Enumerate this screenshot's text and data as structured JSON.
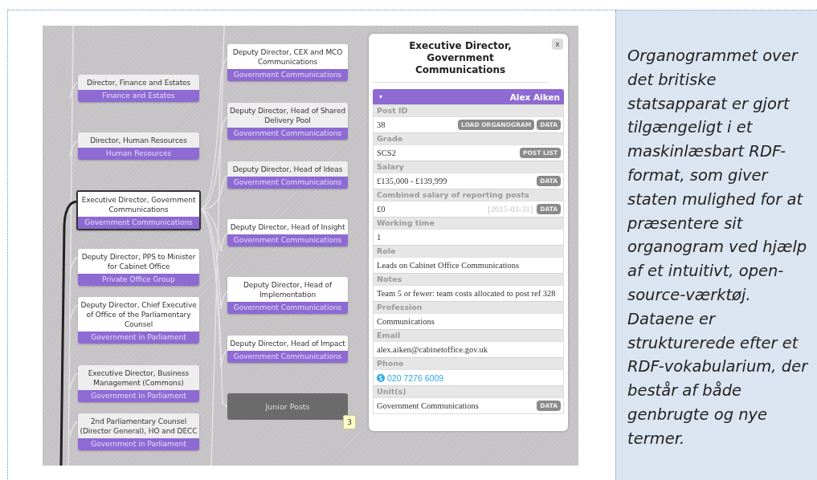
{
  "organogram": {
    "left_nodes": [
      {
        "title": "Director, Finance and Estates",
        "unit": "Finance and Estates",
        "greyed": true,
        "selected": false
      },
      {
        "title": "Director, Human Resources",
        "unit": "Human Resources",
        "greyed": true,
        "selected": false
      },
      {
        "title": "Executive Director, Government Communications",
        "unit": "Government Communications",
        "greyed": false,
        "selected": true
      },
      {
        "title": "Deputy Director, PPS to Minister for Cabinet Office",
        "unit": "Private Office Group",
        "greyed": false,
        "selected": false
      },
      {
        "title": "Deputy Director, Chief Executive of Office of the Parliamentary Counsel",
        "unit": "Government in Parliament",
        "greyed": false,
        "selected": false
      },
      {
        "title": "Executive Director, Business Management (Commons)",
        "unit": "Government in Parliament",
        "greyed": true,
        "selected": false
      },
      {
        "title": "2nd Parliamentary Counsel (Director General), HO and DECC",
        "unit": "Government in Parliament",
        "greyed": true,
        "selected": false
      }
    ],
    "right_nodes": [
      {
        "title": "Deputy Director, CEX and MCO Communications",
        "unit": "Government Communications",
        "greyed": false,
        "selected": false
      },
      {
        "title": "Deputy Director, Head of Shared Delivery Pool",
        "unit": "Government Communications",
        "greyed": true,
        "selected": false
      },
      {
        "title": "Deputy Director, Head of Ideas",
        "unit": "Government Communications",
        "greyed": true,
        "selected": false
      },
      {
        "title": "Deputy Director, Head of Insight",
        "unit": "Government Communications",
        "greyed": false,
        "selected": false
      },
      {
        "title": "Deputy Director, Head of Implementation",
        "unit": "Government Communications",
        "greyed": false,
        "selected": false
      },
      {
        "title": "Deputy Director, Head of Impact",
        "unit": "Government Communications",
        "greyed": false,
        "selected": false
      }
    ],
    "junior_posts": {
      "label": "Junior Posts",
      "count": "3"
    }
  },
  "info_panel": {
    "title": "Executive Director, Government Communications",
    "close": "x",
    "person": {
      "toggle": "▾",
      "name": "Alex Aiken"
    },
    "fields": [
      {
        "label": "Post ID",
        "value": "38",
        "kind": "text",
        "buttons": [
          "LOAD ORGANOGRAM",
          "DATA"
        ]
      },
      {
        "label": "Grade",
        "value": "SCS2",
        "kind": "text",
        "buttons": [
          "POST LIST"
        ]
      },
      {
        "label": "Salary",
        "value": "£135,000 - £139,999",
        "kind": "text",
        "buttons": [
          "DATA"
        ]
      },
      {
        "label": "Combined salary of reporting posts",
        "value": "£0",
        "date": "[2015-03-31]",
        "kind": "text",
        "buttons": [
          "DATA"
        ]
      },
      {
        "label": "Working time",
        "value": "1",
        "kind": "text"
      },
      {
        "label": "Role",
        "value": "Leads on Cabinet Office Communications",
        "kind": "text"
      },
      {
        "label": "Notes",
        "value": "Team 5 or fewer: team costs allocated to post ref 328",
        "kind": "text"
      },
      {
        "label": "Profession",
        "value": "Communications",
        "kind": "text"
      },
      {
        "label": "Email",
        "value": "alex.aiken@cabinetoffice.gov.uk",
        "kind": "text"
      },
      {
        "label": "Phone",
        "value": "020 7276 6009",
        "kind": "phone"
      },
      {
        "label": "Unit(s)",
        "value": "Government Communications",
        "kind": "text",
        "buttons": [
          "DATA"
        ]
      }
    ]
  },
  "caption": "Organogrammet over det britiske statsapparat er gjort tilgængeligt i et maskinlæsbart RDF-format, som giver staten mulighed for at præsentere sit organogram ved hjælp af et intuitivt, open-source-værktøj. Dataene er strukturerede efter et RDF-vokabularium, der består af både genbrugte og nye termer."
}
